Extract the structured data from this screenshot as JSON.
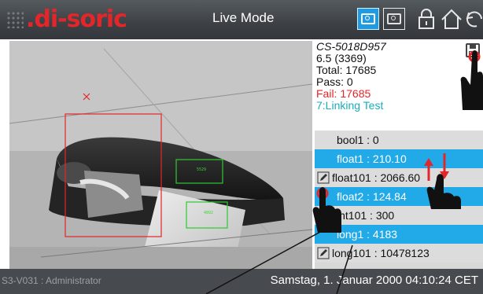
{
  "header": {
    "brand": ".di-soric",
    "title": "Live Mode"
  },
  "toolbar": {
    "buttons": [
      {
        "name": "live-camera-button",
        "icon": "camera-icon",
        "active": true
      },
      {
        "name": "snapshot-camera-button",
        "icon": "camera-icon",
        "active": false
      },
      {
        "name": "lock-button",
        "icon": "lock-icon"
      },
      {
        "name": "home-button",
        "icon": "home-icon"
      },
      {
        "name": "back-button",
        "icon": "undo-arrow-icon"
      }
    ],
    "accent_color": "#1e9be5"
  },
  "live_view": {
    "roi_boxes": [
      {
        "label": "5529",
        "color": "#2ec92e"
      },
      {
        "label": "4892",
        "color": "#2ec92e"
      },
      {
        "label": "",
        "color": "#e3262a"
      }
    ]
  },
  "stats": {
    "device_id": "CS-5018D957",
    "value": "6.5 (3369)",
    "total": "Total: 17685",
    "pass": "Pass: 0",
    "fail": "Fail: 17685",
    "test": "7:Linking Test",
    "fail_color": "#e3262a",
    "test_color": "#18aeb9"
  },
  "results": {
    "rows": [
      {
        "text": "bool1 : 0",
        "editable": false,
        "highlight": false
      },
      {
        "text": "float1 : 210.10",
        "editable": false,
        "highlight": true
      },
      {
        "text": "float101 : 2066.60",
        "editable": true,
        "highlight": false
      },
      {
        "text": "float2 : 124.84",
        "editable": false,
        "highlight": true
      },
      {
        "text": "int101 : 300",
        "editable": false,
        "highlight": false
      },
      {
        "text": "long1 : 4183",
        "editable": false,
        "highlight": true
      },
      {
        "text": "long101 : 10478123",
        "editable": true,
        "highlight": false
      }
    ]
  },
  "status": {
    "user": "S3-V031 : Administrator",
    "datetime": "Samstag, 1. Januar 2000 04:10:24 CET"
  }
}
